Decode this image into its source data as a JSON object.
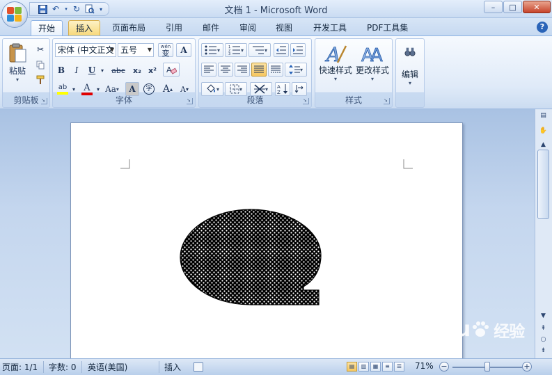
{
  "window": {
    "title": "文档 1 - Microsoft Word",
    "controls": {
      "minimize": "–",
      "restore": "□",
      "close": "✕"
    }
  },
  "quick_access": {
    "icons": [
      "save-icon",
      "undo-icon",
      "redo-icon",
      "print-preview-icon",
      "customize-icon"
    ]
  },
  "tabs": [
    "开始",
    "插入",
    "页面布局",
    "引用",
    "邮件",
    "审阅",
    "视图",
    "开发工具",
    "PDF工具集"
  ],
  "ribbon": {
    "clipboard": {
      "label": "剪贴板",
      "paste_label": "粘贴"
    },
    "font": {
      "label": "字体",
      "font_name": "宋体 (中文正文",
      "font_size": "五号",
      "phonetic_label": "wén",
      "phonetic_char": "变",
      "border_char": "A",
      "bold": "B",
      "italic": "I",
      "underline": "U",
      "strike": "abc",
      "subscript": "x₂",
      "superscript": "x²",
      "change_case": "Aa",
      "char_shading": "A",
      "enclose": "字",
      "grow": "A",
      "shrink": "A",
      "highlight_color": "#ffff00",
      "font_color": "#e00000"
    },
    "paragraph": {
      "label": "段落"
    },
    "styles": {
      "label": "样式",
      "quick_styles": "快速样式",
      "change_styles": "更改样式"
    },
    "editing": {
      "label": "编辑"
    }
  },
  "status": {
    "page": "页面: 1/1",
    "words": "字数: 0",
    "language": "英语(美国)",
    "mode": "插入",
    "zoom": "71%",
    "zoom_level": 0.5
  },
  "watermark": {
    "brand": "Baidu",
    "suffix": "经验"
  }
}
